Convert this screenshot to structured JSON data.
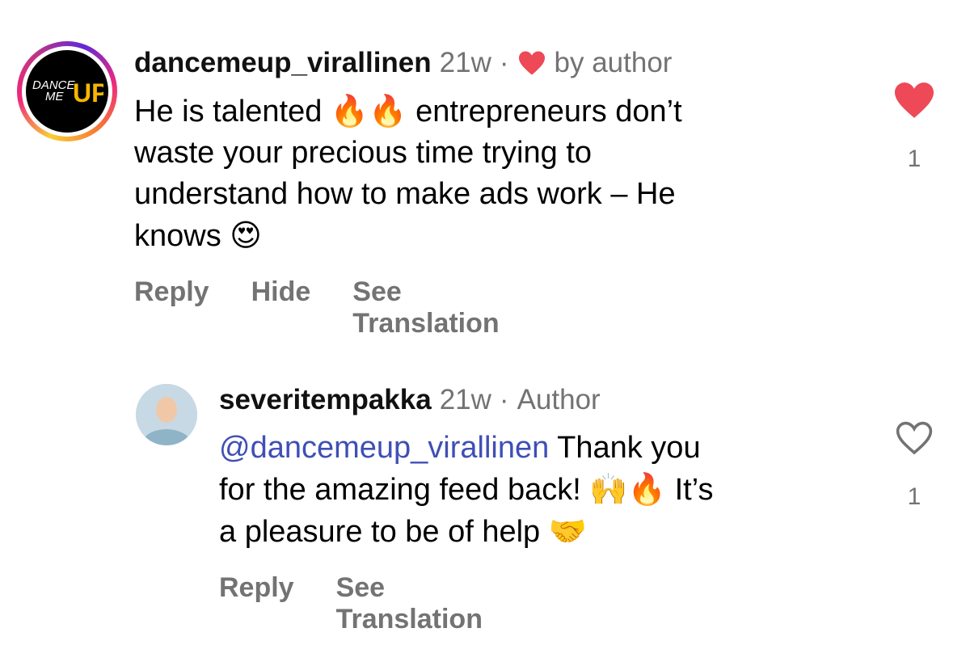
{
  "comments": [
    {
      "avatar": {
        "logo_line1": "DANCE",
        "logo_line2": "ME",
        "logo_up": "UP"
      },
      "username": "dancemeup_virallinen",
      "time": "21w",
      "separator": "·",
      "author_like": "by author",
      "text_part1": "He is talented ",
      "emoji1": "🔥🔥",
      "text_part2": " entrepreneurs don’t",
      "text_line2": "waste your precious time trying to",
      "text_line3": "understand how to make ads work – He",
      "text_line4": "knows ",
      "emoji2": "😍",
      "actions": {
        "reply": "Reply",
        "hide": "Hide",
        "translate": "See Translation"
      },
      "liked": true,
      "like_count": "1"
    },
    {
      "username": "severitempakka",
      "time": "21w",
      "separator": "·",
      "badge": "Author",
      "mention": "@dancemeup_virallinen",
      "text_part1": " Thank you",
      "text_line2": "for the amazing feed back! ",
      "emoji1": "🙌🔥",
      "text_line2b": " It’s",
      "text_line3": "a pleasure to be of help ",
      "emoji2": "🤝",
      "actions": {
        "reply": "Reply",
        "translate": "See Translation"
      },
      "liked": false,
      "like_count": "1"
    }
  ],
  "colors": {
    "like_red": "#ed4956",
    "muted": "#737373",
    "mention": "#3f4fb6"
  },
  "icons": [
    "heart-filled-icon",
    "heart-outline-icon",
    "small-heart-icon"
  ]
}
